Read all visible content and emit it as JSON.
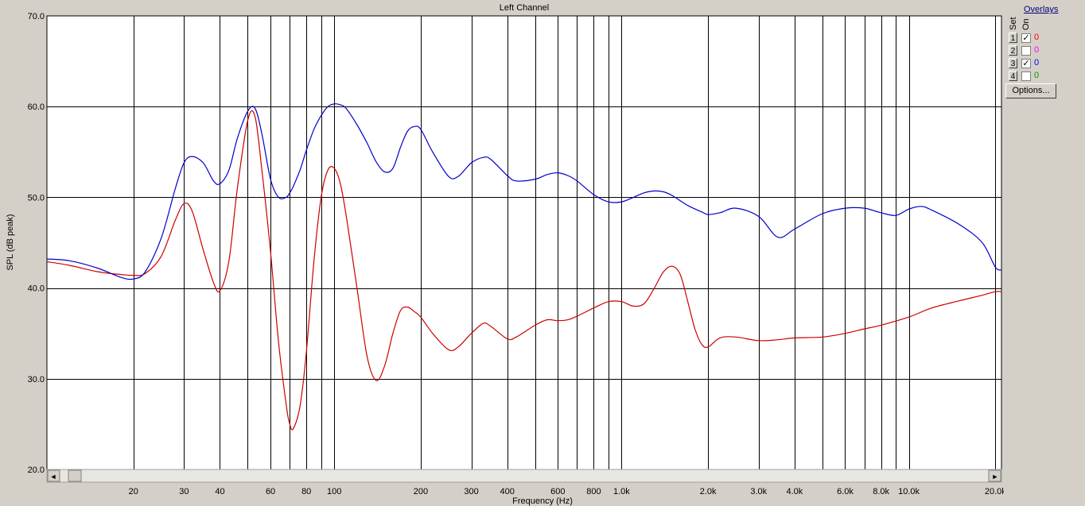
{
  "chart_data": {
    "type": "line",
    "title": "Left Channel",
    "xlabel": "Frequency (Hz)",
    "ylabel": "SPL (dB peak)",
    "xscale": "log",
    "xlim": [
      10,
      21000
    ],
    "ylim": [
      20,
      70
    ],
    "grid": true,
    "yticks": [
      {
        "value": 20,
        "label": "20.0"
      },
      {
        "value": 30,
        "label": "30.0"
      },
      {
        "value": 40,
        "label": "40.0"
      },
      {
        "value": 50,
        "label": "50.0"
      },
      {
        "value": 60,
        "label": "60.0"
      },
      {
        "value": 70,
        "label": "70.0"
      }
    ],
    "xgrid": [
      20,
      30,
      40,
      50,
      60,
      70,
      80,
      90,
      100,
      200,
      300,
      400,
      500,
      600,
      700,
      800,
      900,
      1000,
      2000,
      3000,
      4000,
      5000,
      6000,
      7000,
      8000,
      9000,
      10000,
      20000
    ],
    "xticks": [
      {
        "value": 20,
        "label": "20"
      },
      {
        "value": 30,
        "label": "30"
      },
      {
        "value": 40,
        "label": "40"
      },
      {
        "value": 60,
        "label": "60"
      },
      {
        "value": 80,
        "label": "80"
      },
      {
        "value": 100,
        "label": "100"
      },
      {
        "value": 200,
        "label": "200"
      },
      {
        "value": 300,
        "label": "300"
      },
      {
        "value": 400,
        "label": "400"
      },
      {
        "value": 600,
        "label": "600"
      },
      {
        "value": 800,
        "label": "800"
      },
      {
        "value": 1000,
        "label": "1.0k"
      },
      {
        "value": 2000,
        "label": "2.0k"
      },
      {
        "value": 3000,
        "label": "3.0k"
      },
      {
        "value": 4000,
        "label": "4.0k"
      },
      {
        "value": 6000,
        "label": "6.0k"
      },
      {
        "value": 8000,
        "label": "8.0k"
      },
      {
        "value": 10000,
        "label": "10.0k"
      },
      {
        "value": 20000,
        "label": "20.0k"
      }
    ],
    "series": [
      {
        "color": "#cc0000",
        "x": [
          10,
          12,
          15,
          18,
          20,
          22,
          25,
          28,
          30,
          32,
          35,
          38,
          40,
          43,
          46,
          50,
          53,
          56,
          60,
          64,
          68,
          70,
          72,
          76,
          80,
          85,
          90,
          95,
          100,
          105,
          110,
          120,
          130,
          140,
          150,
          160,
          170,
          180,
          190,
          200,
          220,
          250,
          270,
          300,
          330,
          350,
          400,
          430,
          500,
          550,
          600,
          650,
          700,
          800,
          900,
          1000,
          1100,
          1200,
          1300,
          1400,
          1500,
          1600,
          1700,
          1800,
          1900,
          2000,
          2200,
          2500,
          3000,
          3500,
          4000,
          5000,
          6000,
          7000,
          8000,
          10000,
          12000,
          15000,
          18000,
          20000,
          21000
        ],
        "y": [
          42.9,
          42.5,
          41.8,
          41.5,
          41.4,
          41.6,
          43.5,
          47.5,
          49.3,
          48.5,
          44.2,
          40.6,
          39.7,
          43.0,
          51.0,
          58.5,
          58.9,
          53.0,
          44.0,
          34.0,
          27.2,
          25.0,
          24.5,
          27.0,
          33.0,
          43.0,
          50.0,
          53.0,
          53.2,
          51.5,
          48.0,
          40.0,
          32.5,
          29.8,
          31.5,
          35.0,
          37.5,
          37.9,
          37.4,
          36.8,
          35.0,
          33.2,
          33.5,
          35.0,
          36.1,
          35.8,
          34.4,
          34.6,
          35.9,
          36.5,
          36.4,
          36.5,
          36.9,
          37.8,
          38.5,
          38.5,
          38.0,
          38.3,
          40.0,
          41.8,
          42.4,
          41.5,
          38.5,
          35.5,
          33.8,
          33.5,
          34.5,
          34.6,
          34.2,
          34.3,
          34.5,
          34.6,
          35.0,
          35.5,
          35.9,
          36.8,
          37.8,
          38.6,
          39.2,
          39.6,
          39.6
        ]
      },
      {
        "color": "#0000cc",
        "x": [
          10,
          12,
          15,
          18,
          20,
          22,
          25,
          28,
          30,
          32,
          35,
          38,
          40,
          43,
          46,
          50,
          53,
          56,
          60,
          64,
          68,
          70,
          72,
          76,
          80,
          85,
          90,
          95,
          100,
          105,
          110,
          120,
          130,
          140,
          150,
          160,
          170,
          180,
          190,
          200,
          220,
          250,
          270,
          300,
          330,
          350,
          400,
          430,
          500,
          550,
          600,
          650,
          700,
          800,
          900,
          1000,
          1100,
          1200,
          1300,
          1400,
          1500,
          1700,
          1900,
          2000,
          2200,
          2500,
          3000,
          3500,
          4000,
          5000,
          6000,
          7000,
          8000,
          9000,
          10000,
          11000,
          12000,
          15000,
          18000,
          20000,
          21000
        ],
        "y": [
          43.2,
          43.0,
          42.2,
          41.2,
          41.0,
          41.8,
          45.5,
          51.0,
          53.8,
          54.5,
          53.8,
          51.8,
          51.5,
          53.0,
          56.5,
          59.5,
          59.8,
          57.0,
          52.0,
          50.0,
          50.0,
          50.5,
          51.2,
          53.0,
          55.2,
          57.5,
          59.0,
          60.0,
          60.3,
          60.2,
          59.8,
          58.0,
          56.0,
          53.9,
          52.8,
          53.2,
          55.5,
          57.3,
          57.8,
          57.5,
          55.0,
          52.3,
          52.3,
          53.8,
          54.4,
          54.2,
          52.4,
          51.8,
          52.0,
          52.5,
          52.7,
          52.4,
          51.8,
          50.3,
          49.5,
          49.5,
          50.0,
          50.5,
          50.7,
          50.6,
          50.2,
          49.1,
          48.4,
          48.1,
          48.3,
          48.8,
          47.9,
          45.6,
          46.5,
          48.2,
          48.8,
          48.8,
          48.3,
          48.0,
          48.7,
          49.0,
          48.6,
          47.0,
          45.0,
          42.3,
          42.0
        ]
      }
    ]
  },
  "scrollbar": {
    "left_arrow": "◄",
    "right_arrow": "►"
  },
  "overlays": {
    "title": "Overlays",
    "set_header": "Set",
    "on_header": "On",
    "rows": [
      {
        "num": "1",
        "check": "✓",
        "count": "0",
        "color": "#ff0000"
      },
      {
        "num": "2",
        "check": "",
        "count": "0",
        "color": "#ff00ff"
      },
      {
        "num": "3",
        "check": "✓",
        "count": "0",
        "color": "#0000ff"
      },
      {
        "num": "4",
        "check": "",
        "count": "0",
        "color": "#009900"
      }
    ],
    "options_label": "Options..."
  }
}
